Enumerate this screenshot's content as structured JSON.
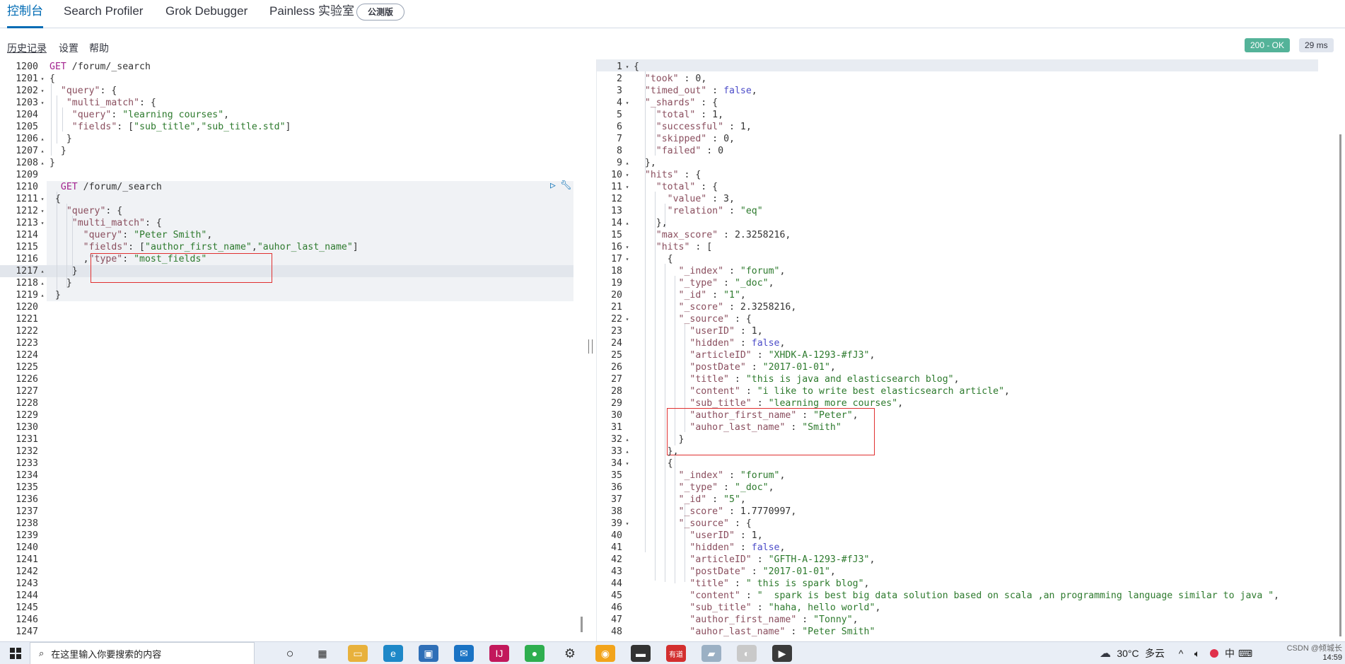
{
  "tabs": [
    {
      "label": "控制台",
      "active": true
    },
    {
      "label": "Search Profiler",
      "active": false
    },
    {
      "label": "Grok Debugger",
      "active": false
    },
    {
      "label": "Painless 实验室",
      "active": false
    }
  ],
  "beta_badge": "公测版",
  "menu": {
    "history": "历史记录",
    "settings": "设置",
    "help": "帮助"
  },
  "status": {
    "code": "200 - OK",
    "time": "29 ms"
  },
  "request_editor": {
    "lines": [
      {
        "n": "1200",
        "fold": "",
        "html": "<span class=\"m\">GET</span> /forum/_search"
      },
      {
        "n": "1201",
        "fold": "▾",
        "html": "{"
      },
      {
        "n": "1202",
        "fold": "▾",
        "html": "  <span class=\"k\">\"query\"</span>: {"
      },
      {
        "n": "1203",
        "fold": "▾",
        "html": "   <span class=\"k\">\"multi_match\"</span>: {"
      },
      {
        "n": "1204",
        "fold": "",
        "html": "    <span class=\"k\">\"query\"</span>: <span class=\"s\">\"learning courses\"</span>,"
      },
      {
        "n": "1205",
        "fold": "",
        "html": "    <span class=\"k\">\"fields\"</span>: [<span class=\"s\">\"sub_title\"</span>,<span class=\"s\">\"sub_title.std\"</span>]"
      },
      {
        "n": "1206",
        "fold": "▴",
        "html": "   }"
      },
      {
        "n": "1207",
        "fold": "▴",
        "html": "  }"
      },
      {
        "n": "1208",
        "fold": "▴",
        "html": "}"
      },
      {
        "n": "1209",
        "fold": "",
        "html": ""
      },
      {
        "n": "1210",
        "fold": "",
        "html": "  <span class=\"m\">GET</span> /forum/_search"
      },
      {
        "n": "1211",
        "fold": "▾",
        "html": " {"
      },
      {
        "n": "1212",
        "fold": "▾",
        "html": "   <span class=\"k\">\"query\"</span>: {"
      },
      {
        "n": "1213",
        "fold": "▾",
        "html": "    <span class=\"k\">\"multi_match\"</span>: {"
      },
      {
        "n": "1214",
        "fold": "",
        "html": "      <span class=\"k\">\"query\"</span>: <span class=\"s\">\"Peter Smith\"</span>,"
      },
      {
        "n": "1215",
        "fold": "",
        "html": "      <span class=\"k\">\"fields\"</span>: [<span class=\"s\">\"author_first_name\"</span>,<span class=\"s\">\"auhor_last_name\"</span>]"
      },
      {
        "n": "1216",
        "fold": "",
        "html": "      ,<span class=\"k\">\"type\"</span>: <span class=\"s\">\"most_fields\"</span>"
      },
      {
        "n": "1217",
        "fold": "▴",
        "html": "    }"
      },
      {
        "n": "1218",
        "fold": "▴",
        "html": "   }"
      },
      {
        "n": "1219",
        "fold": "▴",
        "html": " }"
      },
      {
        "n": "1220",
        "fold": "",
        "html": ""
      },
      {
        "n": "1221",
        "fold": "",
        "html": ""
      },
      {
        "n": "1222",
        "fold": "",
        "html": ""
      },
      {
        "n": "1223",
        "fold": "",
        "html": ""
      },
      {
        "n": "1224",
        "fold": "",
        "html": ""
      },
      {
        "n": "1225",
        "fold": "",
        "html": ""
      },
      {
        "n": "1226",
        "fold": "",
        "html": ""
      },
      {
        "n": "1227",
        "fold": "",
        "html": ""
      },
      {
        "n": "1228",
        "fold": "",
        "html": ""
      },
      {
        "n": "1229",
        "fold": "",
        "html": ""
      },
      {
        "n": "1230",
        "fold": "",
        "html": ""
      },
      {
        "n": "1231",
        "fold": "",
        "html": ""
      },
      {
        "n": "1232",
        "fold": "",
        "html": ""
      },
      {
        "n": "1233",
        "fold": "",
        "html": ""
      },
      {
        "n": "1234",
        "fold": "",
        "html": ""
      },
      {
        "n": "1235",
        "fold": "",
        "html": ""
      },
      {
        "n": "1236",
        "fold": "",
        "html": ""
      },
      {
        "n": "1237",
        "fold": "",
        "html": ""
      },
      {
        "n": "1238",
        "fold": "",
        "html": ""
      },
      {
        "n": "1239",
        "fold": "",
        "html": ""
      },
      {
        "n": "1240",
        "fold": "",
        "html": ""
      },
      {
        "n": "1241",
        "fold": "",
        "html": ""
      },
      {
        "n": "1242",
        "fold": "",
        "html": ""
      },
      {
        "n": "1243",
        "fold": "",
        "html": ""
      },
      {
        "n": "1244",
        "fold": "",
        "html": ""
      },
      {
        "n": "1245",
        "fold": "",
        "html": ""
      },
      {
        "n": "1246",
        "fold": "",
        "html": ""
      },
      {
        "n": "1247",
        "fold": "",
        "html": ""
      }
    ]
  },
  "response_editor": {
    "lines": [
      {
        "n": "1",
        "fold": "▾",
        "html": "{"
      },
      {
        "n": "2",
        "fold": "",
        "html": "  <span class=\"k\">\"took\"</span> : <span class=\"n\">0</span>,"
      },
      {
        "n": "3",
        "fold": "",
        "html": "  <span class=\"k\">\"timed_out\"</span> : <span class=\"bool\">false</span>,"
      },
      {
        "n": "4",
        "fold": "▾",
        "html": "  <span class=\"k\">\"_shards\"</span> : {"
      },
      {
        "n": "5",
        "fold": "",
        "html": "    <span class=\"k\">\"total\"</span> : <span class=\"n\">1</span>,"
      },
      {
        "n": "6",
        "fold": "",
        "html": "    <span class=\"k\">\"successful\"</span> : <span class=\"n\">1</span>,"
      },
      {
        "n": "7",
        "fold": "",
        "html": "    <span class=\"k\">\"skipped\"</span> : <span class=\"n\">0</span>,"
      },
      {
        "n": "8",
        "fold": "",
        "html": "    <span class=\"k\">\"failed\"</span> : <span class=\"n\">0</span>"
      },
      {
        "n": "9",
        "fold": "▴",
        "html": "  },"
      },
      {
        "n": "10",
        "fold": "▾",
        "html": "  <span class=\"k\">\"hits\"</span> : {"
      },
      {
        "n": "11",
        "fold": "▾",
        "html": "    <span class=\"k\">\"total\"</span> : {"
      },
      {
        "n": "12",
        "fold": "",
        "html": "      <span class=\"k\">\"value\"</span> : <span class=\"n\">3</span>,"
      },
      {
        "n": "13",
        "fold": "",
        "html": "      <span class=\"k\">\"relation\"</span> : <span class=\"s\">\"eq\"</span>"
      },
      {
        "n": "14",
        "fold": "▴",
        "html": "    },"
      },
      {
        "n": "15",
        "fold": "",
        "html": "    <span class=\"k\">\"max_score\"</span> : <span class=\"n\">2.3258216</span>,"
      },
      {
        "n": "16",
        "fold": "▾",
        "html": "    <span class=\"k\">\"hits\"</span> : ["
      },
      {
        "n": "17",
        "fold": "▾",
        "html": "      {"
      },
      {
        "n": "18",
        "fold": "",
        "html": "        <span class=\"k\">\"_index\"</span> : <span class=\"s\">\"forum\"</span>,"
      },
      {
        "n": "19",
        "fold": "",
        "html": "        <span class=\"k\">\"_type\"</span> : <span class=\"s\">\"_doc\"</span>,"
      },
      {
        "n": "20",
        "fold": "",
        "html": "        <span class=\"k\">\"_id\"</span> : <span class=\"s\">\"1\"</span>,"
      },
      {
        "n": "21",
        "fold": "",
        "html": "        <span class=\"k\">\"_score\"</span> : <span class=\"n\">2.3258216</span>,"
      },
      {
        "n": "22",
        "fold": "▾",
        "html": "        <span class=\"k\">\"_source\"</span> : {"
      },
      {
        "n": "23",
        "fold": "",
        "html": "          <span class=\"k\">\"userID\"</span> : <span class=\"n\">1</span>,"
      },
      {
        "n": "24",
        "fold": "",
        "html": "          <span class=\"k\">\"hidden\"</span> : <span class=\"bool\">false</span>,"
      },
      {
        "n": "25",
        "fold": "",
        "html": "          <span class=\"k\">\"articleID\"</span> : <span class=\"s\">\"XHDK-A-1293-#fJ3\"</span>,"
      },
      {
        "n": "26",
        "fold": "",
        "html": "          <span class=\"k\">\"postDate\"</span> : <span class=\"s\">\"2017-01-01\"</span>,"
      },
      {
        "n": "27",
        "fold": "",
        "html": "          <span class=\"k\">\"title\"</span> : <span class=\"s\">\"this is java and elasticsearch blog\"</span>,"
      },
      {
        "n": "28",
        "fold": "",
        "html": "          <span class=\"k\">\"content\"</span> : <span class=\"s\">\"i like to write best elasticsearch article\"</span>,"
      },
      {
        "n": "29",
        "fold": "",
        "html": "          <span class=\"k\">\"sub_title\"</span> : <span class=\"s\">\"learning more courses\"</span>,"
      },
      {
        "n": "30",
        "fold": "",
        "html": "          <span class=\"k\">\"author_first_name\"</span> : <span class=\"s\">\"Peter\"</span>,"
      },
      {
        "n": "31",
        "fold": "",
        "html": "          <span class=\"k\">\"auhor_last_name\"</span> : <span class=\"s\">\"Smith\"</span>"
      },
      {
        "n": "32",
        "fold": "▴",
        "html": "        }"
      },
      {
        "n": "33",
        "fold": "▴",
        "html": "      },"
      },
      {
        "n": "34",
        "fold": "▾",
        "html": "      {"
      },
      {
        "n": "35",
        "fold": "",
        "html": "        <span class=\"k\">\"_index\"</span> : <span class=\"s\">\"forum\"</span>,"
      },
      {
        "n": "36",
        "fold": "",
        "html": "        <span class=\"k\">\"_type\"</span> : <span class=\"s\">\"_doc\"</span>,"
      },
      {
        "n": "37",
        "fold": "",
        "html": "        <span class=\"k\">\"_id\"</span> : <span class=\"s\">\"5\"</span>,"
      },
      {
        "n": "38",
        "fold": "",
        "html": "        <span class=\"k\">\"_score\"</span> : <span class=\"n\">1.7770997</span>,"
      },
      {
        "n": "39",
        "fold": "▾",
        "html": "        <span class=\"k\">\"_source\"</span> : {"
      },
      {
        "n": "40",
        "fold": "",
        "html": "          <span class=\"k\">\"userID\"</span> : <span class=\"n\">1</span>,"
      },
      {
        "n": "41",
        "fold": "",
        "html": "          <span class=\"k\">\"hidden\"</span> : <span class=\"bool\">false</span>,"
      },
      {
        "n": "42",
        "fold": "",
        "html": "          <span class=\"k\">\"articleID\"</span> : <span class=\"s\">\"GFTH-A-1293-#fJ3\"</span>,"
      },
      {
        "n": "43",
        "fold": "",
        "html": "          <span class=\"k\">\"postDate\"</span> : <span class=\"s\">\"2017-01-01\"</span>,"
      },
      {
        "n": "44",
        "fold": "",
        "html": "          <span class=\"k\">\"title\"</span> : <span class=\"s\">\" this is spark blog\"</span>,"
      },
      {
        "n": "45",
        "fold": "",
        "html": "          <span class=\"k\">\"content\"</span> : <span class=\"s\">\"  spark is best big data solution based on scala ,an programming language similar to java \"</span>,"
      },
      {
        "n": "46",
        "fold": "",
        "html": "          <span class=\"k\">\"sub_title\"</span> : <span class=\"s\">\"haha, hello world\"</span>,"
      },
      {
        "n": "47",
        "fold": "",
        "html": "          <span class=\"k\">\"author_first_name\"</span> : <span class=\"s\">\"Tonny\"</span>,"
      },
      {
        "n": "48",
        "fold": "",
        "html": "          <span class=\"k\">\"auhor_last_name\"</span> : <span class=\"s\">\"Peter Smith\"</span>"
      }
    ]
  },
  "taskbar": {
    "search_placeholder": "在这里输入你要搜索的内容",
    "weather_temp": "30°C",
    "weather_text": "多云",
    "ime": "中",
    "clock": "14:59",
    "watermark": "CSDN @倾城长"
  },
  "colors": {
    "accent": "#006bb4",
    "ok": "#54b399",
    "annotation": "#e03030"
  }
}
